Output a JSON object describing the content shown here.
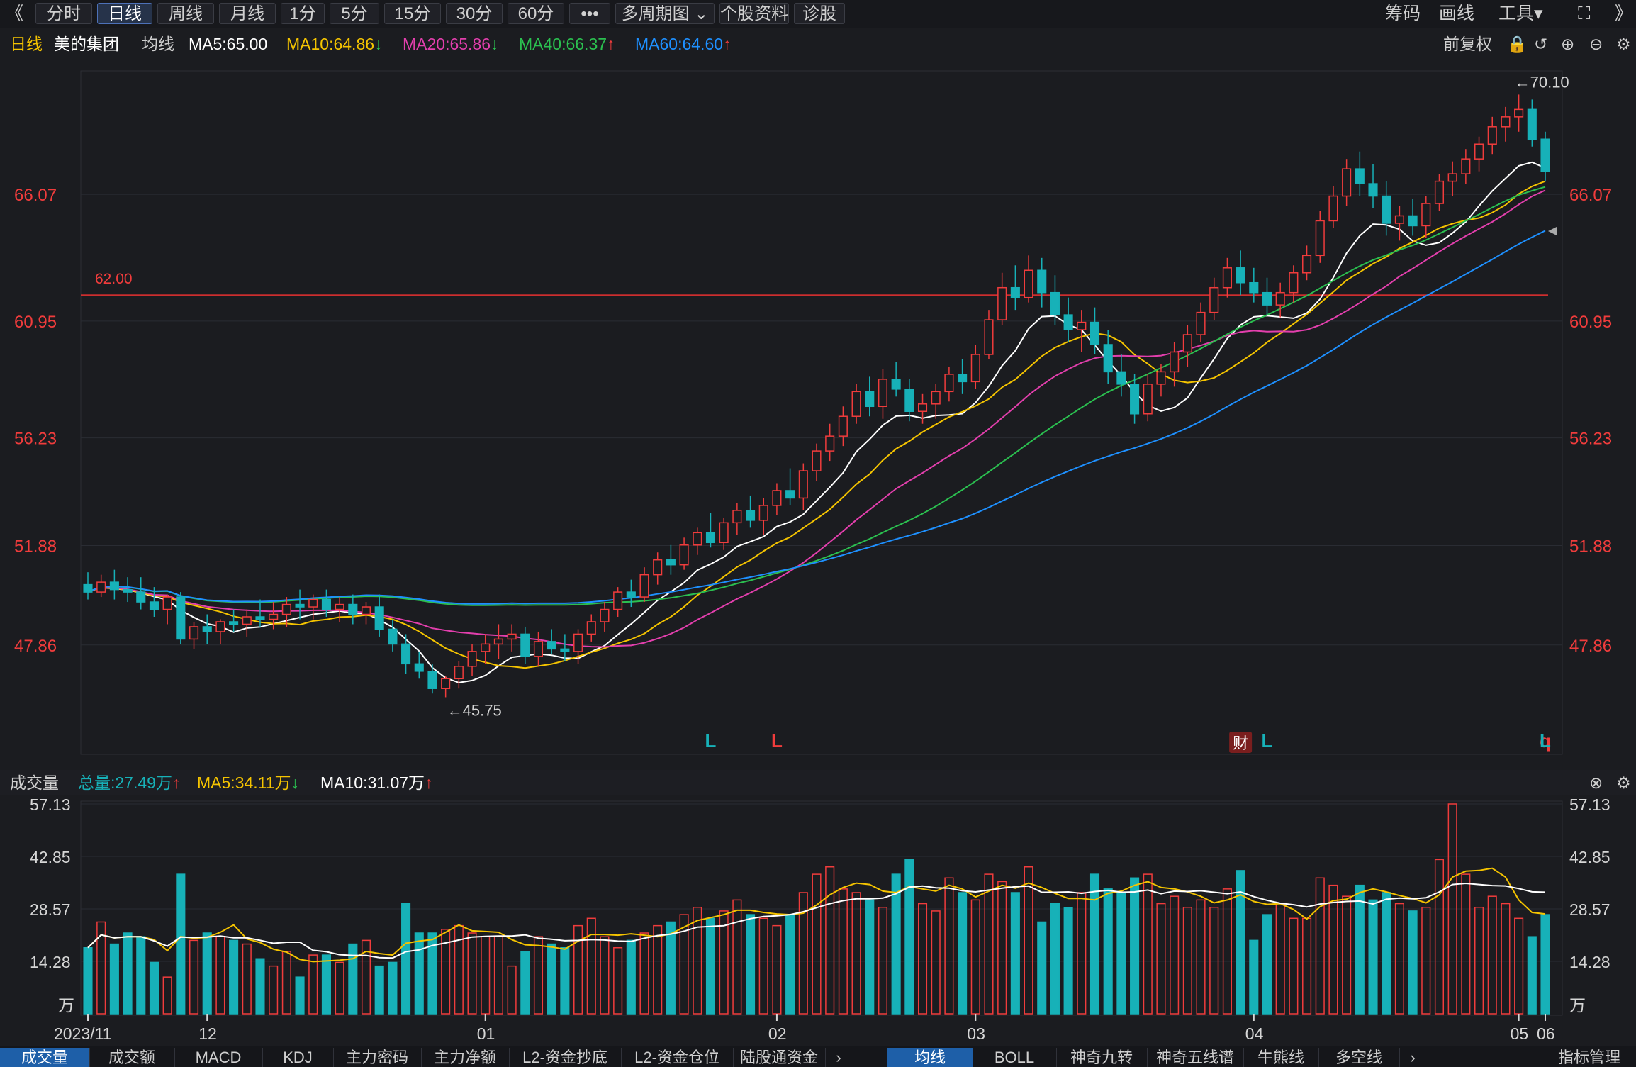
{
  "toolbar": {
    "back_glyph": "《",
    "periods": [
      "分时",
      "日线",
      "周线",
      "月线",
      "1分",
      "5分",
      "15分",
      "30分",
      "60分",
      "•••",
      "多周期图 ⌄",
      "个股资料",
      "诊股"
    ],
    "active_period": "日线",
    "right_items": [
      "筹码",
      "画线",
      "工具▾"
    ],
    "fullscreen_glyph": "⛶",
    "forward_glyph": "》"
  },
  "info": {
    "period": "日线",
    "stock_name": "美的集团",
    "avg_label": "均线",
    "ma5": "MA5:65.00",
    "ma10": "MA10:64.86",
    "ma10_arrow": "↓",
    "ma20": "MA20:65.86",
    "ma20_arrow": "↓",
    "ma40": "MA40:66.37",
    "ma40_arrow": "↑",
    "ma60": "MA60:64.60",
    "ma60_arrow": "↑",
    "adjust": "前复权"
  },
  "vol_info": {
    "title": "成交量",
    "total": "总量:27.49万",
    "total_arrow": "↑",
    "ma5": "MA5:34.11万",
    "ma5_arrow": "↓",
    "ma10": "MA10:31.07万",
    "ma10_arrow": "↑"
  },
  "bottom_tabs_left": [
    "成交量",
    "成交额",
    "MACD",
    "KDJ",
    "主力密码",
    "主力净额",
    "L2-资金抄底",
    "L2-资金仓位",
    "陆股通资金"
  ],
  "bottom_tabs_right": [
    "均线",
    "BOLL",
    "神奇九转",
    "神奇五线谱",
    "牛熊线",
    "多空线"
  ],
  "bottom_right": "指标管理",
  "colors": {
    "up": "#f03c3c",
    "down": "#17b1b8",
    "ma5": "#ffffff",
    "ma10": "#f5c400",
    "ma20": "#e33fad",
    "ma40": "#2bc050",
    "ma60": "#1e90ff",
    "ref": "#e83030"
  },
  "chart_data": {
    "type": "candlestick",
    "price_axis_ticks": [
      "66.07",
      "60.95",
      "56.23",
      "51.88",
      "47.86"
    ],
    "reference_line": {
      "label": "62.00",
      "value": 62.0
    },
    "high_label": "←70.10",
    "low_label": "←45.75",
    "markers": [
      {
        "d": "2024-01-25",
        "text": "L",
        "color": "down"
      },
      {
        "d": "2024-02-01",
        "text": "L",
        "color": "up"
      },
      {
        "d": "2024-03-29",
        "text": "财",
        "color": "badge"
      },
      {
        "d": "2024-04-02",
        "text": "L",
        "color": "down"
      },
      {
        "d": "2024-05-09",
        "text": "q",
        "color": "up"
      },
      {
        "d": "2024-05-16",
        "text": "L",
        "color": "down"
      }
    ],
    "month_labels": [
      {
        "text": "2023/11",
        "d": "2023-11-20"
      },
      {
        "text": "12",
        "d": "2023-12-01"
      },
      {
        "text": "01",
        "d": "2024-01-02"
      },
      {
        "text": "02",
        "d": "2024-02-01"
      },
      {
        "text": "03",
        "d": "2024-03-01"
      },
      {
        "text": "04",
        "d": "2024-04-01"
      },
      {
        "text": "05",
        "d": "2024-05-06"
      },
      {
        "text": "06",
        "d": "2024-06-03"
      }
    ],
    "volume_axis_ticks": [
      "57.13",
      "42.85",
      "28.57",
      "14.28"
    ],
    "volume_unit": "万",
    "ma_labels": [
      "MA5",
      "MA10",
      "MA20",
      "MA40",
      "MA60"
    ],
    "ma_last_values": [
      65.0,
      64.86,
      65.86,
      66.37,
      64.6
    ],
    "vol_ma_labels": [
      "MA5",
      "MA10"
    ],
    "candles": [
      {
        "d": "2023-11-20",
        "o": 50.3,
        "h": 50.8,
        "l": 49.7,
        "c": 50.0,
        "v": 18.0
      },
      {
        "d": "2023-11-21",
        "o": 50.0,
        "h": 50.7,
        "l": 49.8,
        "c": 50.4,
        "v": 25.0
      },
      {
        "d": "2023-11-22",
        "o": 50.4,
        "h": 50.9,
        "l": 49.7,
        "c": 50.1,
        "v": 19.0
      },
      {
        "d": "2023-11-23",
        "o": 50.1,
        "h": 50.6,
        "l": 49.6,
        "c": 50.0,
        "v": 22.0
      },
      {
        "d": "2023-11-24",
        "o": 50.0,
        "h": 50.6,
        "l": 49.3,
        "c": 49.6,
        "v": 21.0
      },
      {
        "d": "2023-11-27",
        "o": 49.6,
        "h": 50.2,
        "l": 49.0,
        "c": 49.3,
        "v": 14.0
      },
      {
        "d": "2023-11-28",
        "o": 49.3,
        "h": 49.9,
        "l": 48.7,
        "c": 49.8,
        "v": 10.0
      },
      {
        "d": "2023-11-29",
        "o": 49.8,
        "h": 50.0,
        "l": 47.9,
        "c": 48.1,
        "v": 38.0
      },
      {
        "d": "2023-11-30",
        "o": 48.1,
        "h": 48.8,
        "l": 47.7,
        "c": 48.6,
        "v": 20.0
      },
      {
        "d": "2023-12-01",
        "o": 48.6,
        "h": 49.1,
        "l": 47.9,
        "c": 48.4,
        "v": 22.0
      },
      {
        "d": "2023-12-04",
        "o": 48.4,
        "h": 48.9,
        "l": 47.9,
        "c": 48.8,
        "v": 21.0
      },
      {
        "d": "2023-12-05",
        "o": 48.8,
        "h": 49.3,
        "l": 48.4,
        "c": 48.7,
        "v": 20.0
      },
      {
        "d": "2023-12-06",
        "o": 48.7,
        "h": 49.3,
        "l": 48.2,
        "c": 49.0,
        "v": 19.0
      },
      {
        "d": "2023-12-07",
        "o": 49.0,
        "h": 49.7,
        "l": 48.6,
        "c": 48.9,
        "v": 15.0
      },
      {
        "d": "2023-12-08",
        "o": 48.9,
        "h": 49.6,
        "l": 48.5,
        "c": 49.1,
        "v": 13.0
      },
      {
        "d": "2023-12-11",
        "o": 49.1,
        "h": 49.8,
        "l": 48.6,
        "c": 49.5,
        "v": 17.0
      },
      {
        "d": "2023-12-12",
        "o": 49.5,
        "h": 50.1,
        "l": 48.9,
        "c": 49.4,
        "v": 10.0
      },
      {
        "d": "2023-12-13",
        "o": 49.4,
        "h": 49.9,
        "l": 48.9,
        "c": 49.7,
        "v": 16.0
      },
      {
        "d": "2023-12-14",
        "o": 49.7,
        "h": 50.1,
        "l": 49.0,
        "c": 49.3,
        "v": 16.0
      },
      {
        "d": "2023-12-15",
        "o": 49.3,
        "h": 49.8,
        "l": 48.8,
        "c": 49.5,
        "v": 14.0
      },
      {
        "d": "2023-12-18",
        "o": 49.5,
        "h": 49.9,
        "l": 48.7,
        "c": 49.1,
        "v": 19.0
      },
      {
        "d": "2023-12-19",
        "o": 49.1,
        "h": 49.6,
        "l": 48.7,
        "c": 49.4,
        "v": 20.0
      },
      {
        "d": "2023-12-20",
        "o": 49.4,
        "h": 49.9,
        "l": 48.2,
        "c": 48.5,
        "v": 13.0
      },
      {
        "d": "2023-12-21",
        "o": 48.5,
        "h": 48.9,
        "l": 47.6,
        "c": 47.9,
        "v": 14.0
      },
      {
        "d": "2023-12-22",
        "o": 47.9,
        "h": 48.3,
        "l": 46.7,
        "c": 47.1,
        "v": 30.0
      },
      {
        "d": "2023-12-25",
        "o": 47.1,
        "h": 47.6,
        "l": 46.5,
        "c": 46.8,
        "v": 22.0
      },
      {
        "d": "2023-12-26",
        "o": 46.8,
        "h": 47.1,
        "l": 45.9,
        "c": 46.1,
        "v": 22.0
      },
      {
        "d": "2023-12-27",
        "o": 46.1,
        "h": 46.6,
        "l": 45.75,
        "c": 46.5,
        "v": 23.0
      },
      {
        "d": "2023-12-28",
        "o": 46.5,
        "h": 47.2,
        "l": 46.1,
        "c": 47.0,
        "v": 24.0
      },
      {
        "d": "2023-12-29",
        "o": 47.0,
        "h": 47.9,
        "l": 46.6,
        "c": 47.6,
        "v": 22.0
      },
      {
        "d": "2024-01-02",
        "o": 47.6,
        "h": 48.3,
        "l": 47.1,
        "c": 47.9,
        "v": 21.0
      },
      {
        "d": "2024-01-03",
        "o": 47.9,
        "h": 48.7,
        "l": 47.3,
        "c": 48.1,
        "v": 21.0
      },
      {
        "d": "2024-01-04",
        "o": 48.1,
        "h": 48.7,
        "l": 47.6,
        "c": 48.3,
        "v": 13.0
      },
      {
        "d": "2024-01-05",
        "o": 48.3,
        "h": 48.6,
        "l": 47.1,
        "c": 47.4,
        "v": 17.0
      },
      {
        "d": "2024-01-08",
        "o": 47.4,
        "h": 48.4,
        "l": 47.0,
        "c": 48.0,
        "v": 21.0
      },
      {
        "d": "2024-01-09",
        "o": 48.0,
        "h": 48.5,
        "l": 47.5,
        "c": 47.7,
        "v": 19.0
      },
      {
        "d": "2024-01-10",
        "o": 47.7,
        "h": 48.3,
        "l": 47.2,
        "c": 47.6,
        "v": 18.0
      },
      {
        "d": "2024-01-11",
        "o": 47.6,
        "h": 48.5,
        "l": 47.1,
        "c": 48.3,
        "v": 24.0
      },
      {
        "d": "2024-01-12",
        "o": 48.3,
        "h": 49.1,
        "l": 48.0,
        "c": 48.8,
        "v": 26.0
      },
      {
        "d": "2024-01-15",
        "o": 48.8,
        "h": 49.6,
        "l": 48.4,
        "c": 49.3,
        "v": 21.0
      },
      {
        "d": "2024-01-16",
        "o": 49.3,
        "h": 50.2,
        "l": 49.0,
        "c": 50.0,
        "v": 18.0
      },
      {
        "d": "2024-01-17",
        "o": 50.0,
        "h": 50.5,
        "l": 49.4,
        "c": 49.8,
        "v": 20.0
      },
      {
        "d": "2024-01-18",
        "o": 49.8,
        "h": 51.0,
        "l": 49.6,
        "c": 50.7,
        "v": 22.0
      },
      {
        "d": "2024-01-19",
        "o": 50.7,
        "h": 51.6,
        "l": 50.3,
        "c": 51.3,
        "v": 24.0
      },
      {
        "d": "2024-01-22",
        "o": 51.3,
        "h": 51.9,
        "l": 50.7,
        "c": 51.1,
        "v": 25.0
      },
      {
        "d": "2024-01-23",
        "o": 51.1,
        "h": 52.2,
        "l": 50.9,
        "c": 51.9,
        "v": 27.0
      },
      {
        "d": "2024-01-24",
        "o": 51.9,
        "h": 52.6,
        "l": 51.5,
        "c": 52.4,
        "v": 29.0
      },
      {
        "d": "2024-01-25",
        "o": 52.4,
        "h": 53.2,
        "l": 51.8,
        "c": 52.0,
        "v": 26.0
      },
      {
        "d": "2024-01-26",
        "o": 52.0,
        "h": 53.0,
        "l": 51.7,
        "c": 52.8,
        "v": 28.0
      },
      {
        "d": "2024-01-29",
        "o": 52.8,
        "h": 53.6,
        "l": 52.3,
        "c": 53.3,
        "v": 31.0
      },
      {
        "d": "2024-01-30",
        "o": 53.3,
        "h": 53.9,
        "l": 52.6,
        "c": 52.9,
        "v": 27.0
      },
      {
        "d": "2024-01-31",
        "o": 52.9,
        "h": 53.8,
        "l": 52.3,
        "c": 53.5,
        "v": 26.0
      },
      {
        "d": "2024-02-01",
        "o": 53.5,
        "h": 54.4,
        "l": 53.1,
        "c": 54.1,
        "v": 24.0
      },
      {
        "d": "2024-02-02",
        "o": 54.1,
        "h": 55.0,
        "l": 53.5,
        "c": 53.8,
        "v": 27.0
      },
      {
        "d": "2024-02-05",
        "o": 53.8,
        "h": 55.2,
        "l": 53.3,
        "c": 54.9,
        "v": 33.0
      },
      {
        "d": "2024-02-06",
        "o": 54.9,
        "h": 56.0,
        "l": 54.5,
        "c": 55.7,
        "v": 38.0
      },
      {
        "d": "2024-02-07",
        "o": 55.7,
        "h": 56.8,
        "l": 55.3,
        "c": 56.3,
        "v": 40.0
      },
      {
        "d": "2024-02-08",
        "o": 56.3,
        "h": 57.5,
        "l": 55.9,
        "c": 57.1,
        "v": 34.0
      },
      {
        "d": "2024-02-19",
        "o": 57.1,
        "h": 58.4,
        "l": 56.8,
        "c": 58.1,
        "v": 33.0
      },
      {
        "d": "2024-02-20",
        "o": 58.1,
        "h": 58.7,
        "l": 57.1,
        "c": 57.5,
        "v": 31.0
      },
      {
        "d": "2024-02-21",
        "o": 57.5,
        "h": 59.0,
        "l": 57.0,
        "c": 58.6,
        "v": 29.0
      },
      {
        "d": "2024-02-22",
        "o": 58.6,
        "h": 59.3,
        "l": 57.9,
        "c": 58.2,
        "v": 38.0
      },
      {
        "d": "2024-02-23",
        "o": 58.2,
        "h": 58.6,
        "l": 56.9,
        "c": 57.3,
        "v": 42.0
      },
      {
        "d": "2024-02-26",
        "o": 57.3,
        "h": 58.0,
        "l": 56.8,
        "c": 57.6,
        "v": 30.0
      },
      {
        "d": "2024-02-27",
        "o": 57.6,
        "h": 58.4,
        "l": 57.0,
        "c": 58.1,
        "v": 28.0
      },
      {
        "d": "2024-02-28",
        "o": 58.1,
        "h": 59.1,
        "l": 57.7,
        "c": 58.8,
        "v": 37.0
      },
      {
        "d": "2024-02-29",
        "o": 58.8,
        "h": 59.4,
        "l": 58.0,
        "c": 58.5,
        "v": 33.0
      },
      {
        "d": "2024-03-01",
        "o": 58.5,
        "h": 60.0,
        "l": 58.2,
        "c": 59.6,
        "v": 31.0
      },
      {
        "d": "2024-03-04",
        "o": 59.6,
        "h": 61.4,
        "l": 59.4,
        "c": 61.0,
        "v": 38.0
      },
      {
        "d": "2024-03-05",
        "o": 61.0,
        "h": 62.9,
        "l": 60.8,
        "c": 62.3,
        "v": 36.0
      },
      {
        "d": "2024-03-06",
        "o": 62.3,
        "h": 63.2,
        "l": 61.4,
        "c": 61.9,
        "v": 33.0
      },
      {
        "d": "2024-03-07",
        "o": 61.9,
        "h": 63.6,
        "l": 61.7,
        "c": 63.0,
        "v": 40.0
      },
      {
        "d": "2024-03-08",
        "o": 63.0,
        "h": 63.5,
        "l": 61.5,
        "c": 62.1,
        "v": 25.0
      },
      {
        "d": "2024-03-11",
        "o": 62.1,
        "h": 62.8,
        "l": 60.8,
        "c": 61.2,
        "v": 30.0
      },
      {
        "d": "2024-03-12",
        "o": 61.2,
        "h": 61.9,
        "l": 60.1,
        "c": 60.6,
        "v": 29.0
      },
      {
        "d": "2024-03-13",
        "o": 60.6,
        "h": 61.4,
        "l": 59.7,
        "c": 60.9,
        "v": 33.0
      },
      {
        "d": "2024-03-14",
        "o": 60.9,
        "h": 61.5,
        "l": 59.6,
        "c": 60.0,
        "v": 38.0
      },
      {
        "d": "2024-03-15",
        "o": 60.0,
        "h": 60.6,
        "l": 58.4,
        "c": 58.9,
        "v": 34.0
      },
      {
        "d": "2024-03-18",
        "o": 58.9,
        "h": 59.6,
        "l": 57.9,
        "c": 58.4,
        "v": 33.0
      },
      {
        "d": "2024-03-19",
        "o": 58.4,
        "h": 58.8,
        "l": 56.8,
        "c": 57.2,
        "v": 37.0
      },
      {
        "d": "2024-03-20",
        "o": 57.2,
        "h": 58.8,
        "l": 56.9,
        "c": 58.4,
        "v": 38.0
      },
      {
        "d": "2024-03-21",
        "o": 58.4,
        "h": 59.2,
        "l": 57.9,
        "c": 58.9,
        "v": 30.0
      },
      {
        "d": "2024-03-22",
        "o": 58.9,
        "h": 60.1,
        "l": 58.3,
        "c": 59.7,
        "v": 32.0
      },
      {
        "d": "2024-03-25",
        "o": 59.7,
        "h": 60.8,
        "l": 59.1,
        "c": 60.4,
        "v": 29.0
      },
      {
        "d": "2024-03-26",
        "o": 60.4,
        "h": 61.7,
        "l": 60.1,
        "c": 61.3,
        "v": 31.0
      },
      {
        "d": "2024-03-27",
        "o": 61.3,
        "h": 62.7,
        "l": 61.0,
        "c": 62.3,
        "v": 29.0
      },
      {
        "d": "2024-03-28",
        "o": 62.3,
        "h": 63.5,
        "l": 61.9,
        "c": 63.1,
        "v": 34.0
      },
      {
        "d": "2024-03-29",
        "o": 63.1,
        "h": 63.8,
        "l": 62.0,
        "c": 62.5,
        "v": 39.0
      },
      {
        "d": "2024-04-01",
        "o": 62.5,
        "h": 63.1,
        "l": 61.7,
        "c": 62.1,
        "v": 20.0
      },
      {
        "d": "2024-04-02",
        "o": 62.1,
        "h": 62.7,
        "l": 61.2,
        "c": 61.6,
        "v": 27.0
      },
      {
        "d": "2024-04-03",
        "o": 61.6,
        "h": 62.5,
        "l": 61.1,
        "c": 62.1,
        "v": 30.0
      },
      {
        "d": "2024-04-08",
        "o": 62.1,
        "h": 63.2,
        "l": 61.7,
        "c": 62.9,
        "v": 26.0
      },
      {
        "d": "2024-04-09",
        "o": 62.9,
        "h": 64.0,
        "l": 62.6,
        "c": 63.6,
        "v": 26.0
      },
      {
        "d": "2024-04-10",
        "o": 63.6,
        "h": 65.4,
        "l": 63.3,
        "c": 65.0,
        "v": 37.0
      },
      {
        "d": "2024-04-11",
        "o": 65.0,
        "h": 66.4,
        "l": 64.7,
        "c": 66.0,
        "v": 35.0
      },
      {
        "d": "2024-04-12",
        "o": 66.0,
        "h": 67.5,
        "l": 65.6,
        "c": 67.1,
        "v": 32.0
      },
      {
        "d": "2024-04-15",
        "o": 67.1,
        "h": 67.8,
        "l": 66.0,
        "c": 66.5,
        "v": 35.0
      },
      {
        "d": "2024-04-16",
        "o": 66.5,
        "h": 67.3,
        "l": 65.5,
        "c": 66.0,
        "v": 31.0
      },
      {
        "d": "2024-04-17",
        "o": 66.0,
        "h": 66.6,
        "l": 64.4,
        "c": 64.9,
        "v": 33.0
      },
      {
        "d": "2024-04-18",
        "o": 64.9,
        "h": 65.6,
        "l": 64.2,
        "c": 65.2,
        "v": 30.0
      },
      {
        "d": "2024-04-19",
        "o": 65.2,
        "h": 65.9,
        "l": 64.4,
        "c": 64.8,
        "v": 28.0
      },
      {
        "d": "2024-04-22",
        "o": 64.8,
        "h": 66.0,
        "l": 64.3,
        "c": 65.7,
        "v": 29.0
      },
      {
        "d": "2024-04-23",
        "o": 65.7,
        "h": 66.9,
        "l": 65.4,
        "c": 66.6,
        "v": 42.0
      },
      {
        "d": "2024-04-24",
        "o": 66.6,
        "h": 67.4,
        "l": 66.0,
        "c": 66.9,
        "v": 57.13
      },
      {
        "d": "2024-04-25",
        "o": 66.9,
        "h": 67.9,
        "l": 66.5,
        "c": 67.5,
        "v": 38.0
      },
      {
        "d": "2024-04-26",
        "o": 67.5,
        "h": 68.4,
        "l": 67.0,
        "c": 68.1,
        "v": 29.0
      },
      {
        "d": "2024-04-29",
        "o": 68.1,
        "h": 69.2,
        "l": 67.7,
        "c": 68.8,
        "v": 32.0
      },
      {
        "d": "2024-04-30",
        "o": 68.8,
        "h": 69.6,
        "l": 68.2,
        "c": 69.2,
        "v": 30.0
      },
      {
        "d": "2024-05-06",
        "o": 69.2,
        "h": 70.1,
        "l": 68.6,
        "c": 69.5,
        "v": 26.0
      },
      {
        "d": "2024-05-07",
        "o": 69.5,
        "h": 69.9,
        "l": 68.0,
        "c": 68.3,
        "v": 21.0
      },
      {
        "d": "2024-05-08",
        "o": 68.3,
        "h": 68.6,
        "l": 66.6,
        "c": 67.0,
        "v": 27.0
      }
    ]
  }
}
